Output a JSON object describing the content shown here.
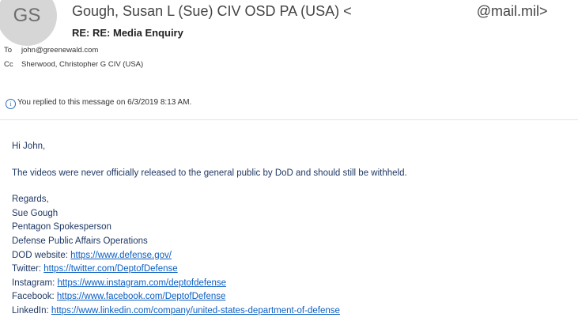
{
  "avatar_initials": "GS",
  "sender": {
    "name": "Gough, Susan L (Sue) CIV OSD PA (USA)",
    "prefix": "<",
    "email_suffix": "@mail.mil>"
  },
  "subject": "RE: RE: Media Enquiry",
  "to": {
    "label": "To",
    "value": "john@greenewald.com"
  },
  "cc": {
    "label": "Cc",
    "value": "Sherwood, Christopher G CIV (USA)"
  },
  "reply_notice": "You replied to this message on 6/3/2019 8:13 AM.",
  "body": {
    "greeting": "Hi John,",
    "message": "The videos were never officially released to the general public by DoD and should still be withheld.",
    "regards": "Regards,",
    "sig_name": "Sue Gough",
    "sig_title": "Pentagon Spokesperson",
    "sig_org": "Defense Public Affairs Operations",
    "links": [
      {
        "label": "DOD website:",
        "url": "https://www.defense.gov/"
      },
      {
        "label": "Twitter:",
        "url": "https://twitter.com/DeptofDefense"
      },
      {
        "label": "Instagram:",
        "url": "https://www.instagram.com/deptofdefense"
      },
      {
        "label": "Facebook:",
        "url": "https://www.facebook.com/DeptofDefense"
      },
      {
        "label": "LinkedIn:",
        "url": "https://www.linkedin.com/company/united-states-department-of-defense"
      }
    ]
  },
  "colors": {
    "body_text": "#1f3864",
    "link": "#0b5ec2",
    "avatar_bg": "#d6d6d6"
  }
}
